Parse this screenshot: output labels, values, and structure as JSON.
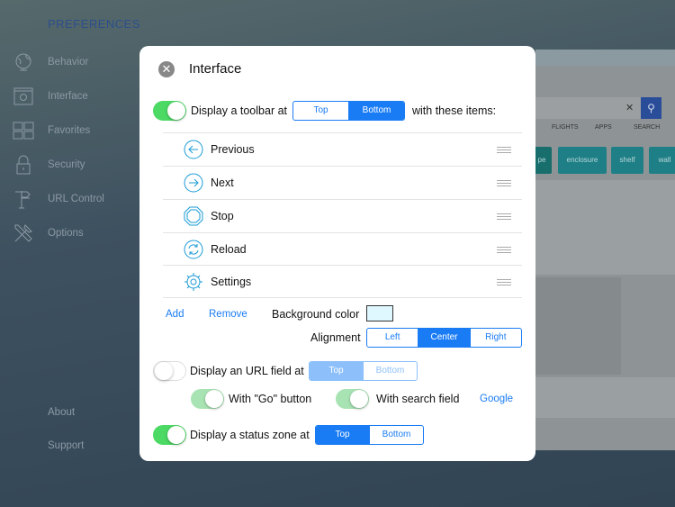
{
  "sidebar": {
    "title": "PREFERENCES",
    "items": [
      {
        "label": "Behavior",
        "icon": "globe-icon"
      },
      {
        "label": "Interface",
        "icon": "window-gear-icon"
      },
      {
        "label": "Favorites",
        "icon": "grid-icon"
      },
      {
        "label": "Security",
        "icon": "lock-icon"
      },
      {
        "label": "URL Control",
        "icon": "signpost-icon"
      },
      {
        "label": "Options",
        "icon": "tools-icon"
      }
    ],
    "about": "About",
    "support": "Support"
  },
  "preview": {
    "nav": [
      "FLIGHTS",
      "APPS",
      "SEARCH"
    ],
    "tags": [
      "pe",
      "enclosure",
      "shelf",
      "wall"
    ]
  },
  "dialog": {
    "title": "Interface",
    "toolbar": {
      "label": "Display a toolbar at",
      "enabled": true,
      "options": [
        "Top",
        "Bottom"
      ],
      "selected": "Bottom",
      "suffix": "with these items:"
    },
    "items": [
      {
        "label": "Previous",
        "icon": "arrow-left-icon"
      },
      {
        "label": "Next",
        "icon": "arrow-right-icon"
      },
      {
        "label": "Stop",
        "icon": "stop-octagon-icon"
      },
      {
        "label": "Reload",
        "icon": "reload-icon"
      },
      {
        "label": "Settings",
        "icon": "gear-icon"
      }
    ],
    "add": "Add",
    "remove": "Remove",
    "bg_color_label": "Background color",
    "bg_color": "#dff7ff",
    "alignment": {
      "label": "Alignment",
      "options": [
        "Left",
        "Center",
        "Right"
      ],
      "selected": "Center"
    },
    "url": {
      "label": "Display an URL field at",
      "enabled": false,
      "options": [
        "Top",
        "Bottom"
      ],
      "selected": "Top",
      "go_label": "With \"Go\" button",
      "go": true,
      "search_label": "With search field",
      "search": true,
      "engine": "Google"
    },
    "status": {
      "label": "Display a status zone at",
      "enabled": true,
      "options": [
        "Top",
        "Bottom"
      ],
      "selected": "Top"
    }
  },
  "colors": {
    "accent": "#1a7cf5",
    "toggle_on": "#4cd964"
  }
}
